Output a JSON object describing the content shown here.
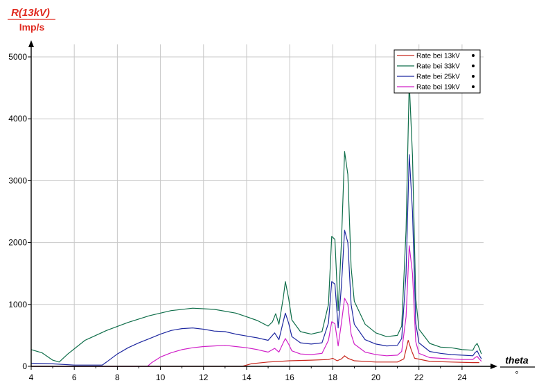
{
  "chart_data": {
    "type": "line",
    "ylabel": "R(13kV)",
    "yunit": "Imp/s",
    "xlabel": "theta",
    "xunit": "°",
    "xlim": [
      4,
      25
    ],
    "ylim": [
      0,
      5000
    ],
    "xticks": [
      "4",
      "6",
      "8",
      "10",
      "12",
      "14",
      "16",
      "18",
      "20",
      "22",
      "24"
    ],
    "yticks": [
      "0",
      "1000",
      "2000",
      "3000",
      "4000",
      "5000"
    ],
    "grid": true,
    "legend_position": "top-right",
    "series": [
      {
        "name": "Rate bei 13kV",
        "color": "#c8281e",
        "points": [
          [
            4,
            0
          ],
          [
            13.8,
            0
          ],
          [
            14.2,
            40
          ],
          [
            15,
            70
          ],
          [
            16,
            90
          ],
          [
            17,
            100
          ],
          [
            17.8,
            110
          ],
          [
            18,
            130
          ],
          [
            18.2,
            90
          ],
          [
            18.4,
            120
          ],
          [
            18.55,
            170
          ],
          [
            18.7,
            130
          ],
          [
            19,
            90
          ],
          [
            20,
            70
          ],
          [
            21,
            70
          ],
          [
            21.3,
            120
          ],
          [
            21.5,
            420
          ],
          [
            21.65,
            260
          ],
          [
            21.8,
            130
          ],
          [
            22.5,
            80
          ],
          [
            23.5,
            70
          ],
          [
            24.5,
            60
          ],
          [
            24.8,
            60
          ]
        ]
      },
      {
        "name": "Rate bei 33kV",
        "color": "#0f6e4a",
        "points": [
          [
            4,
            270
          ],
          [
            4.5,
            220
          ],
          [
            5,
            100
          ],
          [
            5.3,
            70
          ],
          [
            5.7,
            200
          ],
          [
            6.5,
            420
          ],
          [
            7.5,
            580
          ],
          [
            8.5,
            710
          ],
          [
            9.5,
            820
          ],
          [
            10.5,
            900
          ],
          [
            11.5,
            940
          ],
          [
            12.5,
            920
          ],
          [
            13.5,
            860
          ],
          [
            14,
            800
          ],
          [
            14.5,
            740
          ],
          [
            15,
            650
          ],
          [
            15.2,
            720
          ],
          [
            15.35,
            850
          ],
          [
            15.5,
            680
          ],
          [
            15.7,
            1100
          ],
          [
            15.8,
            1370
          ],
          [
            15.95,
            1100
          ],
          [
            16.1,
            750
          ],
          [
            16.5,
            560
          ],
          [
            17,
            520
          ],
          [
            17.5,
            560
          ],
          [
            17.8,
            1000
          ],
          [
            17.95,
            2100
          ],
          [
            18.1,
            2050
          ],
          [
            18.25,
            900
          ],
          [
            18.4,
            2000
          ],
          [
            18.55,
            3470
          ],
          [
            18.7,
            3100
          ],
          [
            18.85,
            1600
          ],
          [
            19,
            1050
          ],
          [
            19.5,
            680
          ],
          [
            20,
            540
          ],
          [
            20.5,
            480
          ],
          [
            21,
            500
          ],
          [
            21.2,
            650
          ],
          [
            21.4,
            2200
          ],
          [
            21.55,
            4600
          ],
          [
            21.7,
            3400
          ],
          [
            21.85,
            1100
          ],
          [
            22,
            600
          ],
          [
            22.5,
            370
          ],
          [
            23,
            310
          ],
          [
            23.5,
            300
          ],
          [
            24,
            270
          ],
          [
            24.5,
            260
          ],
          [
            24.6,
            330
          ],
          [
            24.7,
            370
          ],
          [
            24.8,
            290
          ],
          [
            24.9,
            200
          ]
        ]
      },
      {
        "name": "Rate bei 25kV",
        "color": "#1e28a0",
        "points": [
          [
            4,
            50
          ],
          [
            5,
            40
          ],
          [
            6,
            20
          ],
          [
            7.3,
            20
          ],
          [
            7.5,
            70
          ],
          [
            8,
            200
          ],
          [
            8.5,
            300
          ],
          [
            9,
            380
          ],
          [
            9.5,
            450
          ],
          [
            10,
            520
          ],
          [
            10.5,
            580
          ],
          [
            11,
            610
          ],
          [
            11.5,
            620
          ],
          [
            12,
            600
          ],
          [
            12.5,
            570
          ],
          [
            13,
            560
          ],
          [
            13.5,
            520
          ],
          [
            14,
            490
          ],
          [
            14.5,
            460
          ],
          [
            15,
            420
          ],
          [
            15.3,
            540
          ],
          [
            15.5,
            430
          ],
          [
            15.7,
            720
          ],
          [
            15.8,
            860
          ],
          [
            15.95,
            700
          ],
          [
            16.1,
            480
          ],
          [
            16.5,
            380
          ],
          [
            17,
            360
          ],
          [
            17.5,
            380
          ],
          [
            17.8,
            700
          ],
          [
            17.95,
            1370
          ],
          [
            18.1,
            1330
          ],
          [
            18.25,
            620
          ],
          [
            18.4,
            1300
          ],
          [
            18.55,
            2200
          ],
          [
            18.7,
            2000
          ],
          [
            18.85,
            1000
          ],
          [
            19,
            680
          ],
          [
            19.5,
            430
          ],
          [
            20,
            360
          ],
          [
            20.5,
            330
          ],
          [
            21,
            340
          ],
          [
            21.2,
            450
          ],
          [
            21.4,
            1500
          ],
          [
            21.55,
            3420
          ],
          [
            21.7,
            2500
          ],
          [
            21.85,
            700
          ],
          [
            22,
            380
          ],
          [
            22.5,
            240
          ],
          [
            23,
            210
          ],
          [
            23.5,
            190
          ],
          [
            24,
            180
          ],
          [
            24.5,
            170
          ],
          [
            24.6,
            220
          ],
          [
            24.7,
            250
          ],
          [
            24.8,
            180
          ],
          [
            24.9,
            120
          ]
        ]
      },
      {
        "name": "Rate bei 19kV",
        "color": "#d020c8",
        "points": [
          [
            4,
            0
          ],
          [
            9.4,
            0
          ],
          [
            9.6,
            60
          ],
          [
            10,
            150
          ],
          [
            10.5,
            220
          ],
          [
            11,
            270
          ],
          [
            11.5,
            300
          ],
          [
            12,
            320
          ],
          [
            12.5,
            330
          ],
          [
            13,
            340
          ],
          [
            13.5,
            320
          ],
          [
            14,
            300
          ],
          [
            14.5,
            270
          ],
          [
            15,
            230
          ],
          [
            15.3,
            290
          ],
          [
            15.5,
            230
          ],
          [
            15.7,
            380
          ],
          [
            15.8,
            450
          ],
          [
            15.95,
            360
          ],
          [
            16.1,
            250
          ],
          [
            16.5,
            200
          ],
          [
            17,
            190
          ],
          [
            17.5,
            210
          ],
          [
            17.8,
            420
          ],
          [
            17.95,
            720
          ],
          [
            18.1,
            690
          ],
          [
            18.25,
            330
          ],
          [
            18.4,
            700
          ],
          [
            18.55,
            1100
          ],
          [
            18.7,
            1000
          ],
          [
            18.85,
            520
          ],
          [
            19,
            360
          ],
          [
            19.5,
            230
          ],
          [
            20,
            190
          ],
          [
            20.5,
            170
          ],
          [
            21,
            180
          ],
          [
            21.2,
            240
          ],
          [
            21.4,
            800
          ],
          [
            21.55,
            1950
          ],
          [
            21.7,
            1500
          ],
          [
            21.85,
            400
          ],
          [
            22,
            210
          ],
          [
            22.5,
            140
          ],
          [
            23,
            130
          ],
          [
            23.5,
            120
          ],
          [
            24,
            110
          ],
          [
            24.5,
            110
          ],
          [
            24.6,
            140
          ],
          [
            24.7,
            160
          ],
          [
            24.8,
            120
          ],
          [
            24.9,
            80
          ]
        ]
      }
    ]
  }
}
